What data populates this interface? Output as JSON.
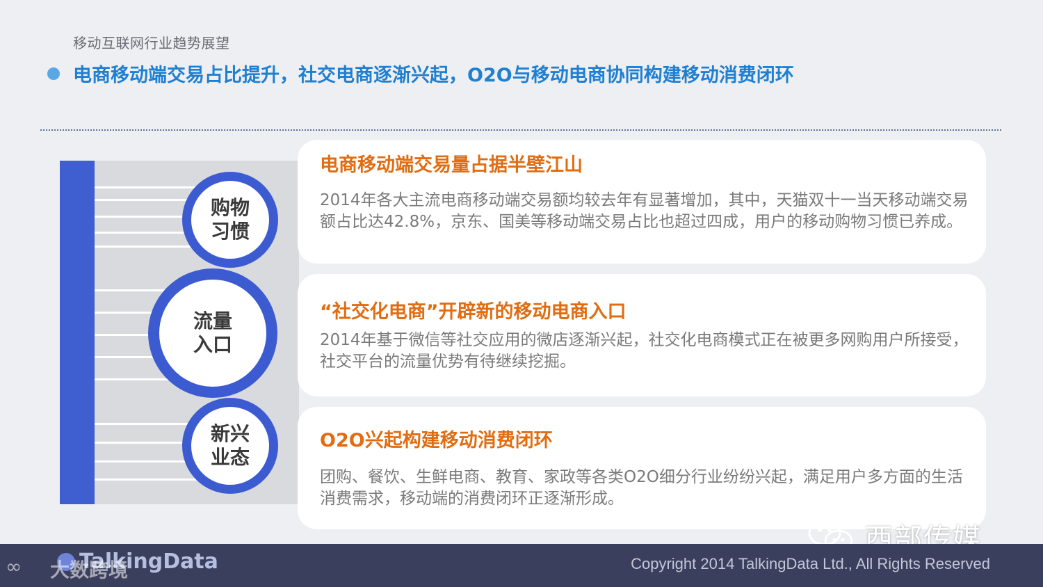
{
  "header": {
    "breadcrumb": "移动互联网行业趋势展望",
    "headline": "电商移动端交易占比提升，社交电商逐渐兴起，O2O与移动电商协同构建移动消费闭环"
  },
  "rings": [
    {
      "label": "购物习惯"
    },
    {
      "label": "流量入口"
    },
    {
      "label": "新兴业态"
    }
  ],
  "cards": [
    {
      "title": "电商移动端交易量占据半壁江山",
      "body": "2014年各大主流电商移动端交易额均较去年有显著增加，其中，天猫双十一当天移动端交易额占比达42.8%，京东、国美等移动端交易占比也超过四成，用户的移动购物习惯已养成。"
    },
    {
      "title": "“社交化电商”开辟新的移动电商入口",
      "body": "2014年基于微信等社交应用的微店逐渐兴起，社交化电商模式正在被更多网购用户所接受，社交平台的流量优势有待继续挖掘。"
    },
    {
      "title": "O2O兴起构建移动消费闭环",
      "body": "团购、餐饮、生鲜电商、教育、家政等各类O2O细分行业纷纷兴起，满足用户多方面的生活消费需求，移动端的消费闭环正逐渐形成。"
    }
  ],
  "footer": {
    "brand": "TalkingData",
    "copyright": "Copyright 2014 TalkingData Ltd., All Rights Reserved",
    "watermark_left": "大数跨境",
    "watermark_right": "西部传媒"
  },
  "colors": {
    "accent_blue": "#1f7fd0",
    "bar_blue": "#3f5ecf",
    "title_orange": "#e06d12",
    "footer_bg": "#3b3f5e"
  }
}
